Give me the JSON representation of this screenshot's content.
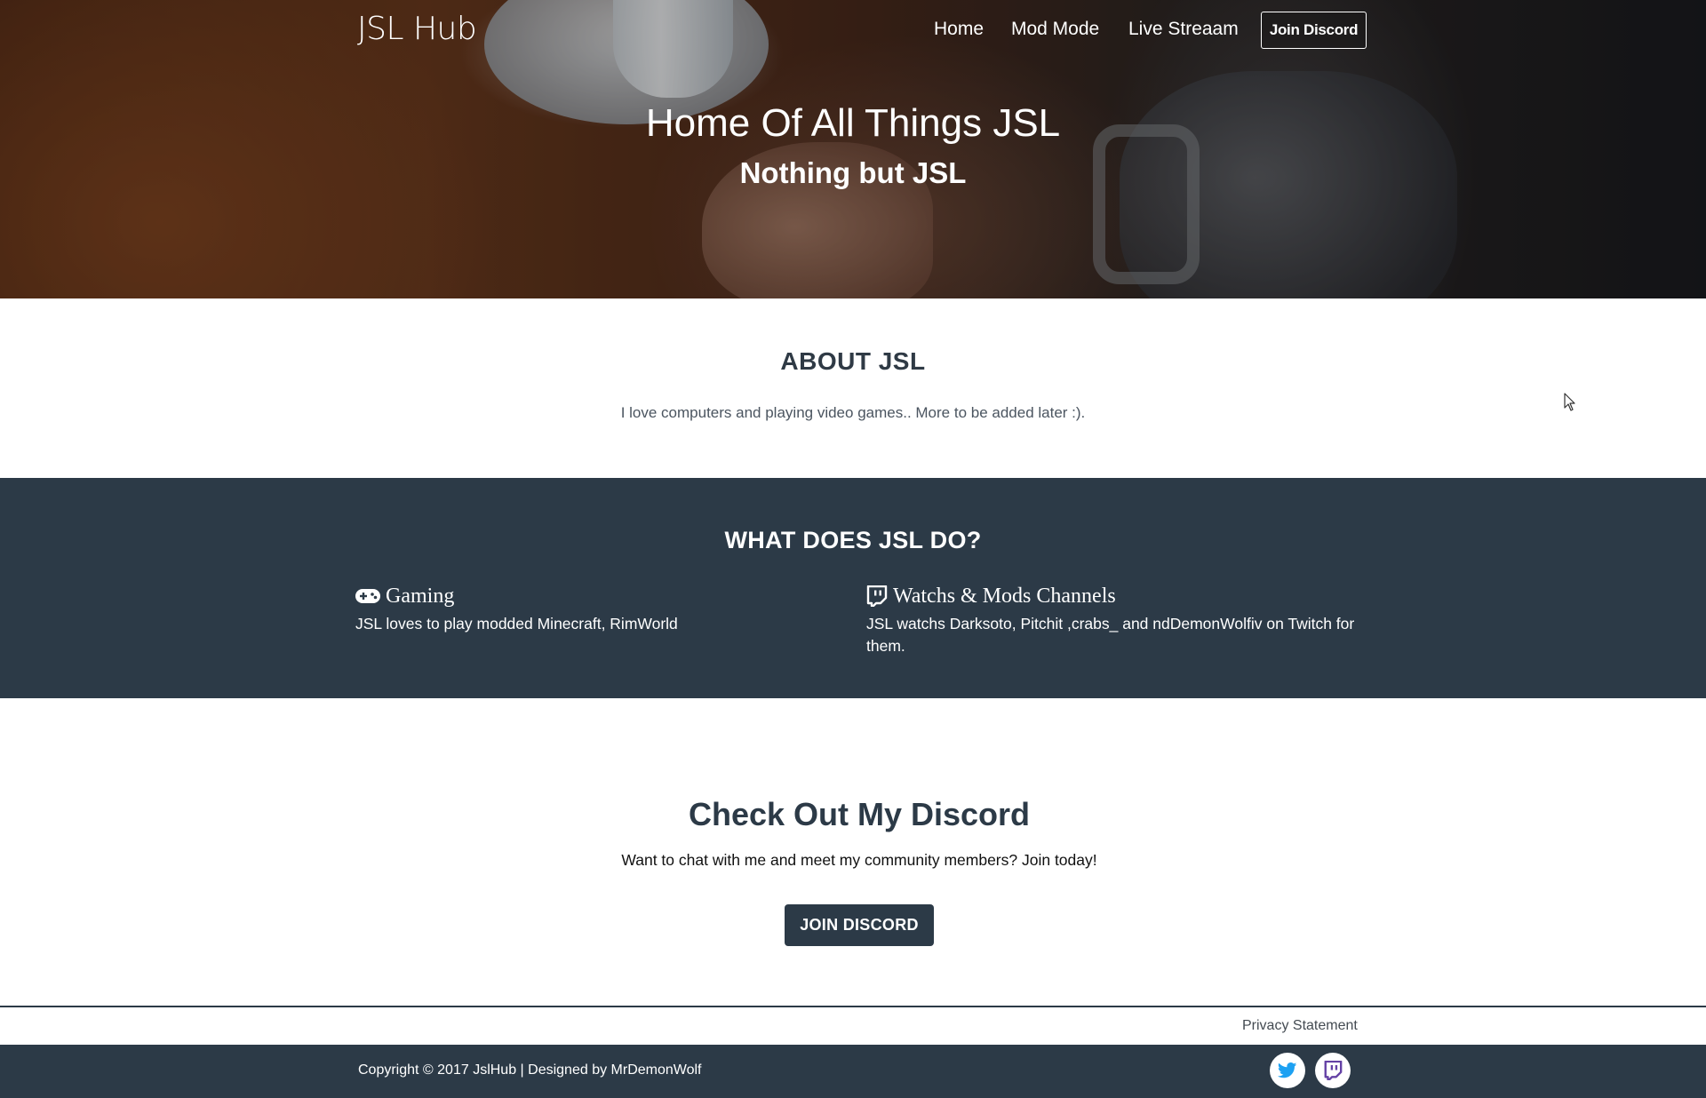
{
  "header": {
    "brand": "JSL Hub",
    "nav": {
      "home": "Home",
      "mod_mode": "Mod Mode",
      "live_stream": "Live Streaam",
      "join_discord": "Join Discord"
    }
  },
  "hero": {
    "title": "Home Of All Things JSL",
    "subtitle": "Nothing but JSL"
  },
  "about": {
    "title": "ABOUT JSL",
    "text": "I love computers and playing video games.. More to be added later :)."
  },
  "services": {
    "title": "WHAT DOES JSL DO?",
    "items": [
      {
        "icon": "gamepad-icon",
        "name": "Gaming",
        "description": "JSL loves to play modded Minecraft, RimWorld"
      },
      {
        "icon": "twitch-icon",
        "name": "Watchs & Mods Channels",
        "description": "JSL watchs Darksoto, Pitchit ,crabs_ and ndDemonWolfiv on Twitch for them."
      }
    ]
  },
  "cta": {
    "title": "Check Out My Discord",
    "text": "Want to chat with me and meet my community members? Join today!",
    "button": "JOIN DISCORD"
  },
  "footer": {
    "privacy": "Privacy Statement",
    "copyright": "Copyright © 2017 JslHub | Designed by MrDemonWolf",
    "social": [
      "twitter-icon",
      "twitch-icon"
    ]
  },
  "colors": {
    "primary_dark": "#2c3a47",
    "twitter": "#1da1f2",
    "twitch": "#6441a5"
  }
}
